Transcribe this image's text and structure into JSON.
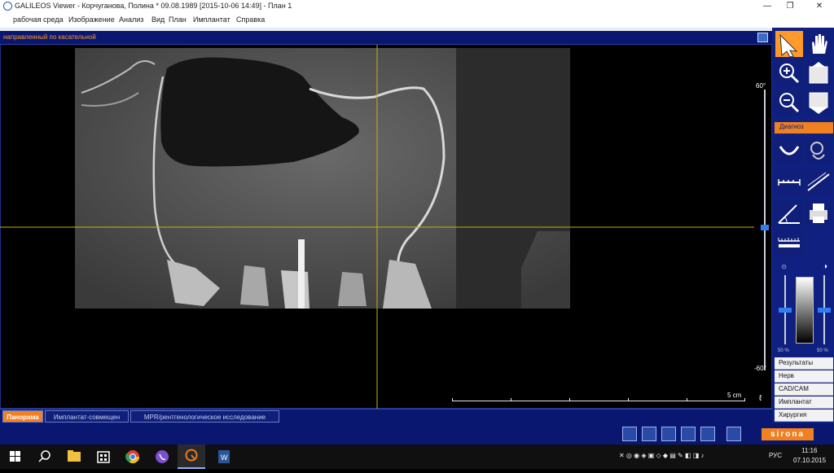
{
  "window": {
    "title": "GALILEOS Viewer - Корчуганова, Полина * 09.08.1989 [2015-10-06 14:49] - План 1",
    "controls": [
      "minimize",
      "maximize",
      "close"
    ]
  },
  "menubar": {
    "items": [
      {
        "label": "рабочая среда"
      },
      {
        "label": "Изображение"
      },
      {
        "label": "Анализ"
      },
      {
        "label": "Вид"
      },
      {
        "label": "План"
      },
      {
        "label": "Имплантат"
      },
      {
        "label": "Справка"
      }
    ]
  },
  "viewer": {
    "title": "направленный по касательной",
    "slider_top_label": "60°",
    "slider_bottom_label": "-60°",
    "scale_label": "5 cm"
  },
  "tabs": [
    {
      "label": "Панорама",
      "active": true
    },
    {
      "label": "Имплантат-совмещен",
      "active": false
    },
    {
      "label": "MPR/рентгенологическое исследование",
      "active": false
    }
  ],
  "right_panel": {
    "diag_header": "Диагноз",
    "contrast_left_label": "50 %",
    "contrast_right_label": "50 %",
    "list": [
      {
        "label": "Результаты"
      },
      {
        "label": "Нерв"
      },
      {
        "label": "CAD/CAM"
      },
      {
        "label": "Имплантат"
      },
      {
        "label": "Хирургия"
      }
    ]
  },
  "brand": "sirona",
  "taskbar": {
    "lang": "РУС",
    "time": "11:16",
    "date": "07.10.2015"
  },
  "colors": {
    "accent_orange": "#f08020",
    "panel_blue": "#102080",
    "header_navy": "#0a1770",
    "crosshair": "#c8b400"
  }
}
